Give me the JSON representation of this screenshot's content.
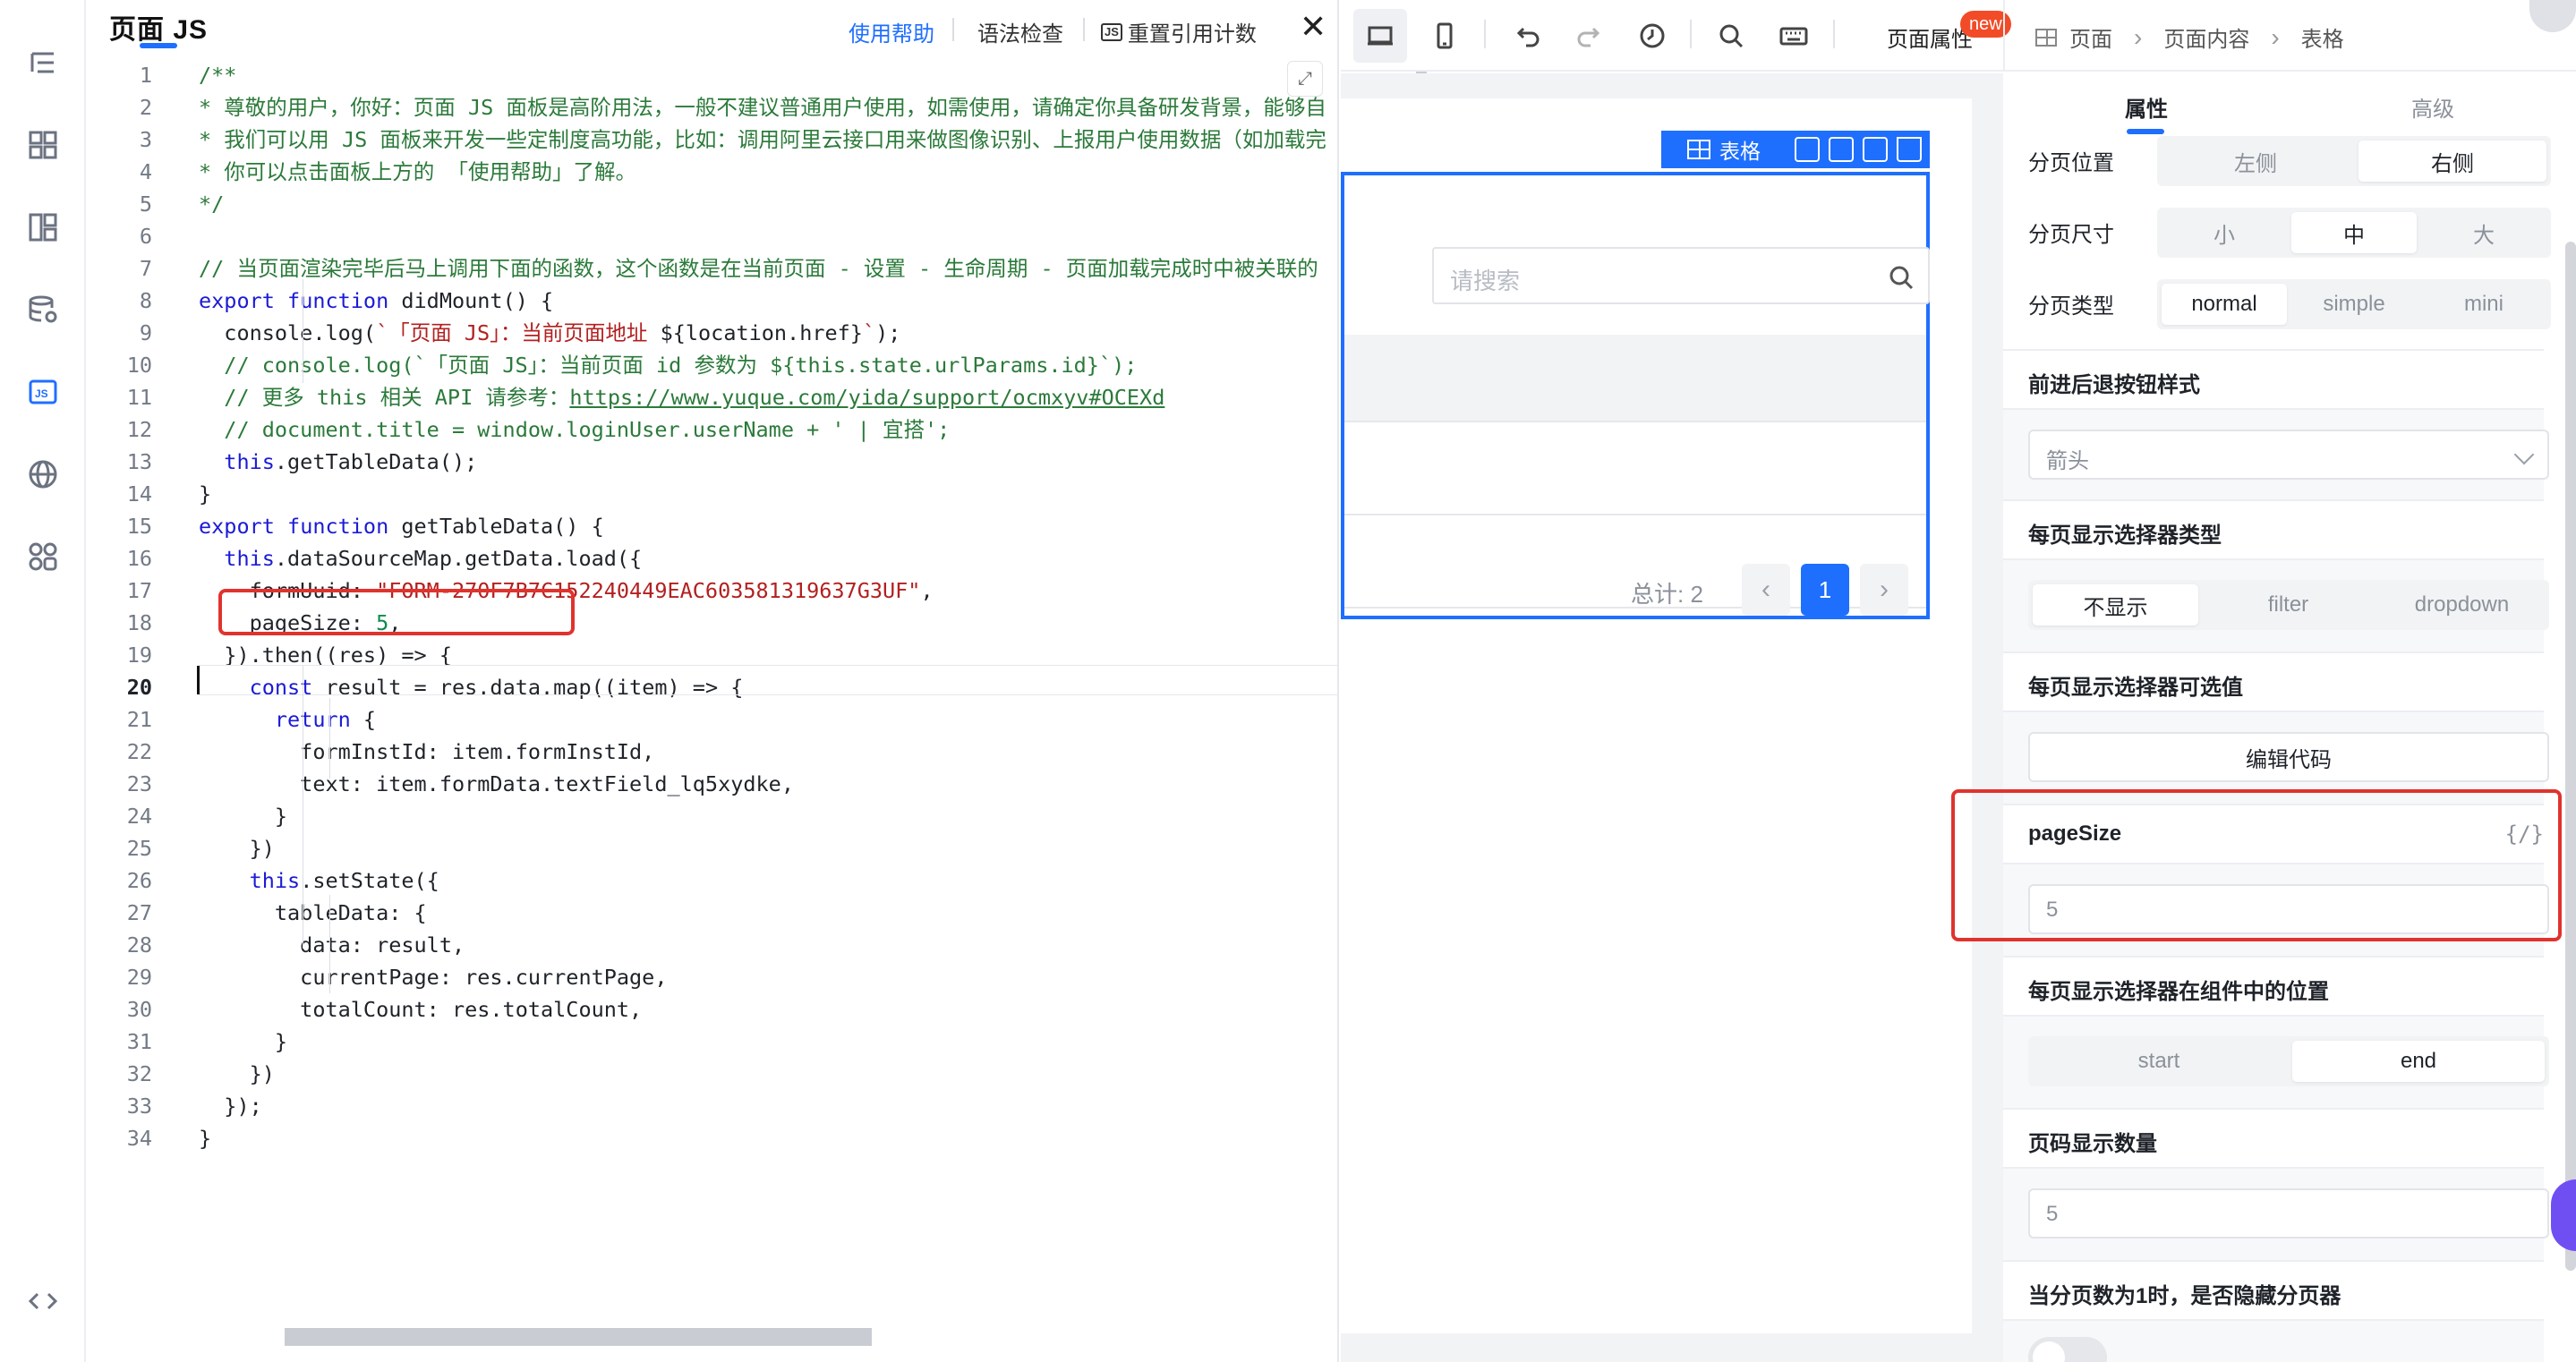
{
  "js_panel": {
    "title": "页面 JS",
    "help_link": "使用帮助",
    "lint": "语法检查",
    "reset_count_badge": "JS",
    "reset_count": "重置引用计数",
    "close": "✕"
  },
  "code": {
    "lines": [
      {
        "n": "1",
        "html": "<span class=\"cmt\">/**</span>"
      },
      {
        "n": "2",
        "html": "<span class=\"cmt\">* 尊敬的用户，你好：页面 JS 面板是高阶用法，一般不建议普通用户使用，如需使用，请确定你具备研发背景，能够自</span>"
      },
      {
        "n": "3",
        "html": "<span class=\"cmt\">* 我们可以用 JS 面板来开发一些定制度高功能，比如：调用阿里云接口用来做图像识别、上报用户使用数据（如加载完</span>"
      },
      {
        "n": "4",
        "html": "<span class=\"cmt\">* 你可以点击面板上方的 「使用帮助」了解。</span>"
      },
      {
        "n": "5",
        "html": "<span class=\"cmt\">*/</span>"
      },
      {
        "n": "6",
        "html": ""
      },
      {
        "n": "7",
        "html": "<span class=\"cmt\">// 当页面渲染完毕后马上调用下面的函数，这个函数是在当前页面 - 设置 - 生命周期 - 页面加载完成时中被关联的</span>"
      },
      {
        "n": "8",
        "html": "<span class=\"kw\">export</span> <span class=\"kw\">function</span> didMount() {"
      },
      {
        "n": "9",
        "html": "  console.log(<span class=\"str\">`「页面 JS」：当前页面地址 </span>${location.href}<span class=\"str\">`</span>);"
      },
      {
        "n": "10",
        "html": "  <span class=\"cmt\">// console.log(`「页面 JS」：当前页面 id 参数为 ${this.state.urlParams.id}`);</span>"
      },
      {
        "n": "11",
        "html": "  <span class=\"cmt\">// 更多 this 相关 API 请参考：<span class=\"link\">https://www.yuque.com/yida/support/ocmxyv#OCEXd</span></span>"
      },
      {
        "n": "12",
        "html": "  <span class=\"cmt\">// document.title = window.loginUser.userName + ' | 宜搭';</span>"
      },
      {
        "n": "13",
        "html": "  <span class=\"kw\">this</span>.getTableData();"
      },
      {
        "n": "14",
        "html": "}"
      },
      {
        "n": "15",
        "html": "<span class=\"kw\">export</span> <span class=\"kw\">function</span> getTableData() {"
      },
      {
        "n": "16",
        "html": "  <span class=\"kw\">this</span>.dataSourceMap.getData.load({"
      },
      {
        "n": "17",
        "html": "    formUuid: <span class=\"str\">\"FORM-270F7B7C152240449EAC603581319637G3UF\"</span>,"
      },
      {
        "n": "18",
        "html": "    pageSize: <span class=\"num\">5</span>,"
      },
      {
        "n": "19",
        "html": "  }).then((res) =&gt; {"
      },
      {
        "n": "20",
        "html": "    <span class=\"kw\">const</span> result = res.data.map((item) =&gt; {"
      },
      {
        "n": "21",
        "html": "      <span class=\"kw\">return</span> {"
      },
      {
        "n": "22",
        "html": "        formInstId: item.formInstId,"
      },
      {
        "n": "23",
        "html": "        text: item.formData.textField_lq5xydke,"
      },
      {
        "n": "24",
        "html": "      }"
      },
      {
        "n": "25",
        "html": "    })"
      },
      {
        "n": "26",
        "html": "    <span class=\"kw\">this</span>.setState({"
      },
      {
        "n": "27",
        "html": "      tableData: {"
      },
      {
        "n": "28",
        "html": "        data: result,"
      },
      {
        "n": "29",
        "html": "        currentPage: res.currentPage,"
      },
      {
        "n": "30",
        "html": "        totalCount: res.totalCount,"
      },
      {
        "n": "31",
        "html": "      }"
      },
      {
        "n": "32",
        "html": "    })"
      },
      {
        "n": "33",
        "html": "  });"
      },
      {
        "n": "34",
        "html": "}"
      }
    ],
    "current_line": "20"
  },
  "canvas": {
    "table_tag": "表格",
    "search_placeholder": "请搜索",
    "total_label": "总计: 2",
    "page_prev": "‹",
    "page_current": "1",
    "page_next": "›"
  },
  "header": {
    "page_props": "页面属性",
    "new_badge": "new",
    "crumbs": [
      "页面",
      "页面内容",
      "表格"
    ]
  },
  "props": {
    "tab_props": "属性",
    "tab_advanced": "高级",
    "pager_position": {
      "label": "分页位置",
      "options": [
        "左侧",
        "右侧"
      ],
      "selected": "右侧"
    },
    "pager_size": {
      "label": "分页尺寸",
      "options": [
        "小",
        "中",
        "大"
      ],
      "selected": "中"
    },
    "pager_type": {
      "label": "分页类型",
      "options": [
        "normal",
        "simple",
        "mini"
      ],
      "selected": "normal"
    },
    "nav_style": {
      "title": "前进后退按钮样式",
      "value": "箭头"
    },
    "selector_type": {
      "title": "每页显示选择器类型",
      "options": [
        "不显示",
        "filter",
        "dropdown"
      ],
      "selected": "不显示"
    },
    "selector_options": {
      "title": "每页显示选择器可选值",
      "button": "编辑代码"
    },
    "page_size": {
      "title": "pageSize",
      "var_icon": "{/}",
      "value": "5"
    },
    "selector_position": {
      "title": "每页显示选择器在组件中的位置",
      "options": [
        "start",
        "end"
      ],
      "selected": "end"
    },
    "page_count": {
      "title": "页码显示数量",
      "value": "5"
    },
    "hide_single": {
      "title": "当分页数为1时，是否隐藏分页器"
    }
  }
}
